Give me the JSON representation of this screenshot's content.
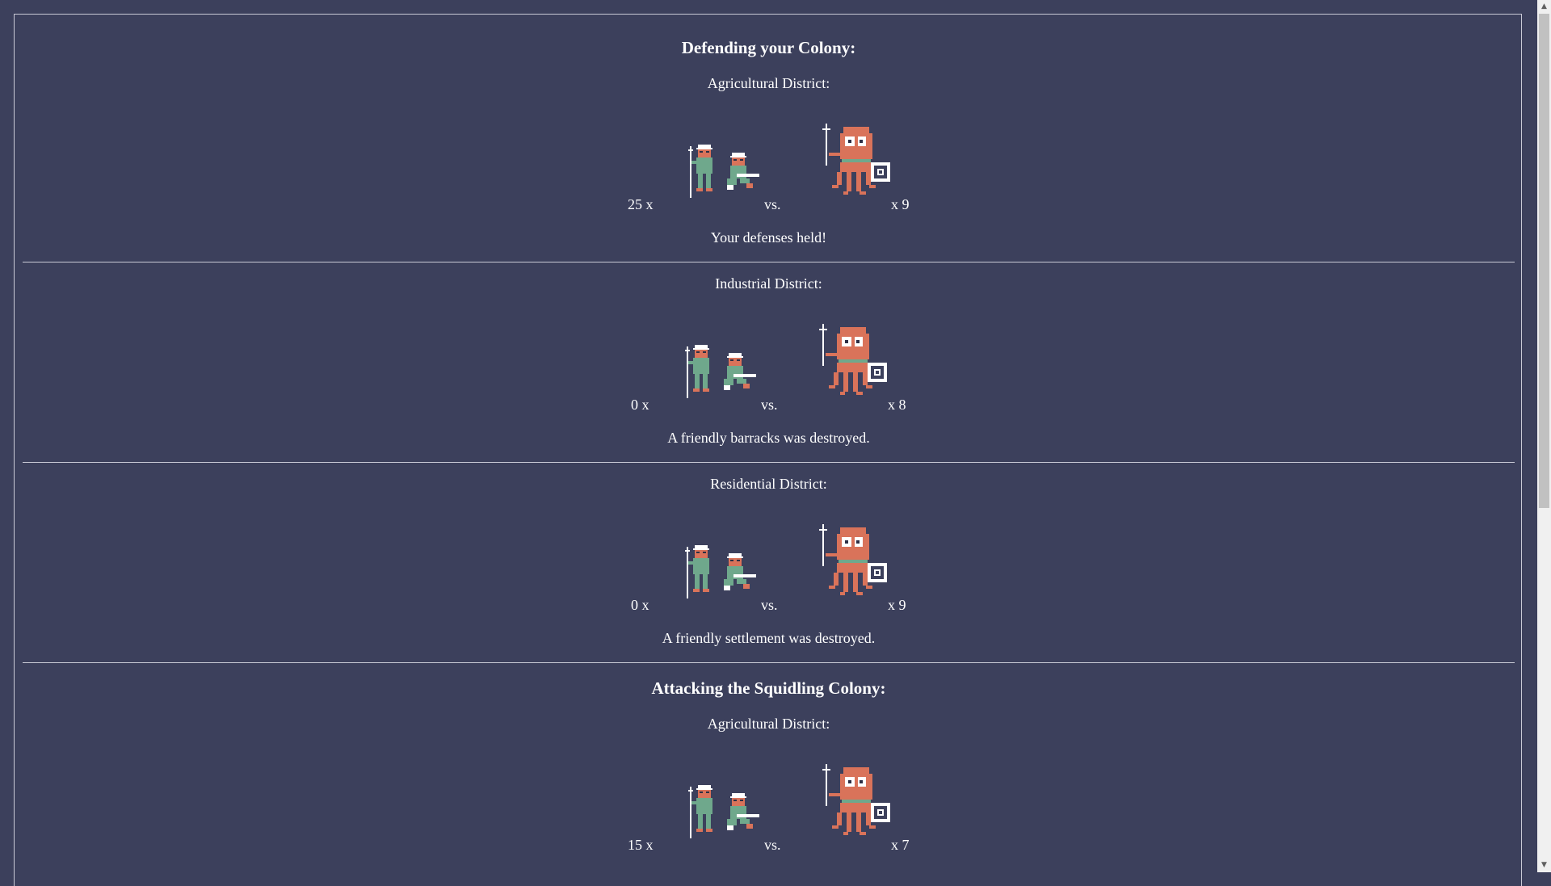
{
  "sections": [
    {
      "title": "Defending your Colony:",
      "districts": [
        {
          "name": "Agricultural District:",
          "left_count": "25 x",
          "vs": "vs.",
          "right_count": "x 9",
          "result": "Your defenses held!"
        },
        {
          "name": "Industrial District:",
          "left_count": "0 x",
          "vs": "vs.",
          "right_count": "x 8",
          "result": "A friendly barracks was destroyed."
        },
        {
          "name": "Residential District:",
          "left_count": "0 x",
          "vs": "vs.",
          "right_count": "x 9",
          "result": "A friendly settlement was destroyed."
        }
      ]
    },
    {
      "title": "Attacking the Squidling Colony:",
      "districts": [
        {
          "name": "Agricultural District:",
          "left_count": "15 x",
          "vs": "vs.",
          "right_count": "x 7",
          "result": ""
        }
      ]
    }
  ],
  "colors": {
    "background": "#3c405c",
    "soldier_body": "#6fa88c",
    "soldier_skin": "#d9735a",
    "squid_body": "#d9735a",
    "white": "#ffffff"
  },
  "icons": {
    "friendly": "soldier-squad-icon",
    "enemy": "squidling-warrior-icon"
  }
}
